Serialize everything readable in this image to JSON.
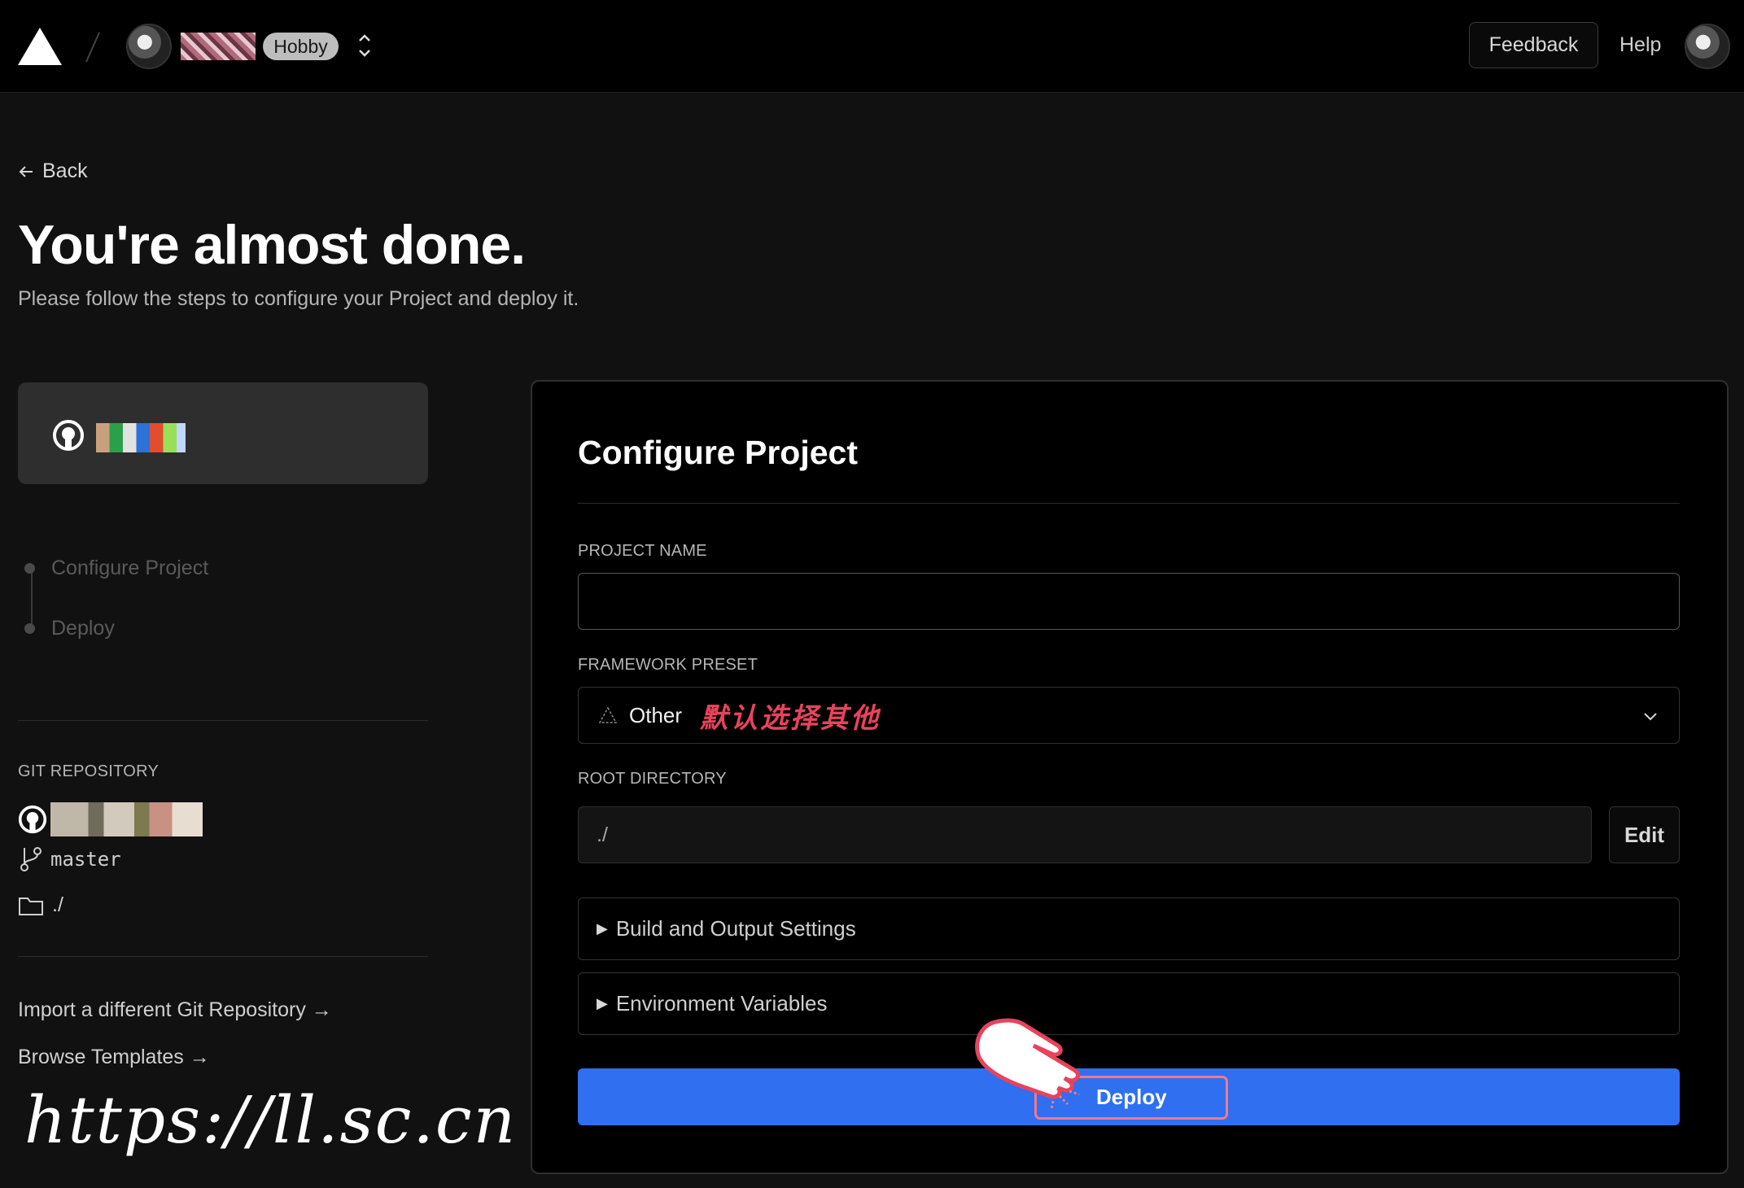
{
  "header": {
    "team_badge": "Hobby",
    "feedback_label": "Feedback",
    "help_label": "Help"
  },
  "page": {
    "back_label": "Back",
    "title": "You're almost done.",
    "subtitle": "Please follow the steps to configure your Project and deploy it."
  },
  "steps": [
    {
      "label": "Configure Project"
    },
    {
      "label": "Deploy"
    }
  ],
  "git": {
    "heading": "GIT REPOSITORY",
    "branch": "master",
    "directory": "./"
  },
  "links": {
    "import_repo": "Import a different Git Repository →",
    "browse_templates": "Browse Templates →"
  },
  "watermark": "https://ll.sc.cn",
  "configure": {
    "title": "Configure Project",
    "project_name_label": "PROJECT NAME",
    "project_name_value": "",
    "framework_label": "FRAMEWORK PRESET",
    "framework_value": "Other",
    "framework_note": "默认选择其他",
    "root_dir_label": "ROOT DIRECTORY",
    "root_dir_value": "./",
    "edit_label": "Edit",
    "build_settings_label": "Build and Output Settings",
    "env_vars_label": "Environment Variables",
    "deploy_label": "Deploy"
  },
  "colors": {
    "deploy_blue": "#2f6ff0",
    "annotation_pink": "#f27890",
    "annotation_red": "#e8435c"
  },
  "icons": [
    "vercel-logo-icon",
    "github-icon",
    "branch-icon",
    "folder-icon",
    "chevron-down-icon",
    "arrow-left-icon",
    "pointer-hand-icon"
  ]
}
